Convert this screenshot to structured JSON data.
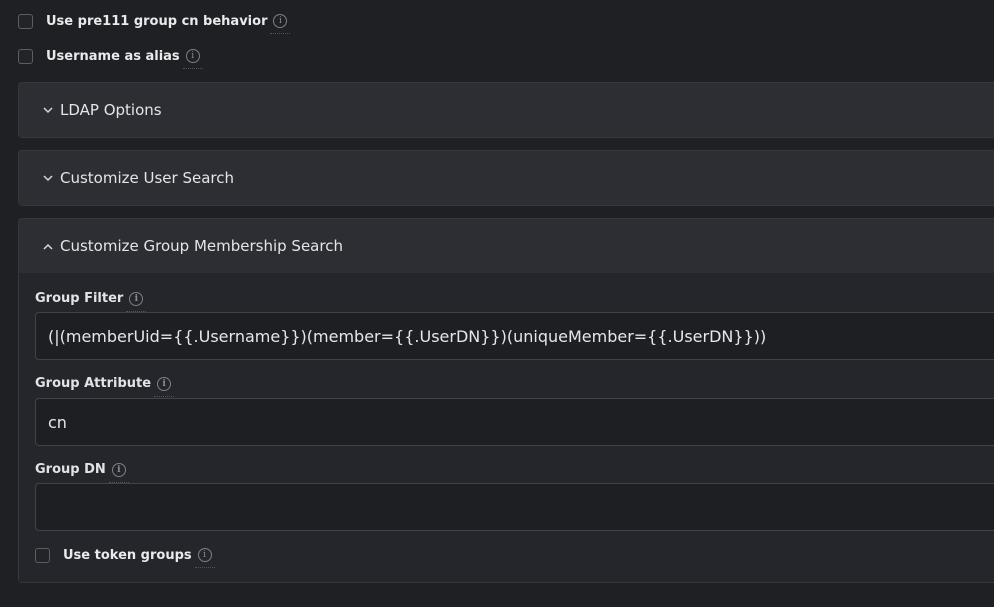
{
  "options": {
    "pre111_label": "Use pre111 group cn behavior",
    "alias_label": "Username as alias"
  },
  "sections": {
    "ldap_options": "LDAP Options",
    "user_search": "Customize User Search",
    "group_search": "Customize Group Membership Search"
  },
  "group_search": {
    "filter_label": "Group Filter",
    "filter_value": "(|(memberUid={{.Username}})(member={{.UserDN}})(uniqueMember={{.UserDN}}))",
    "attribute_label": "Group Attribute",
    "attribute_value": "cn",
    "dn_label": "Group DN",
    "dn_value": "",
    "token_groups_label": "Use token groups"
  },
  "icons": {
    "info": "info-circle-icon",
    "chevron_down": "chevron-down-icon",
    "chevron_up": "chevron-up-icon"
  },
  "colors": {
    "background": "#1f2023",
    "section_header": "#2d2e33",
    "section_body": "#25262b",
    "input_bg": "#1e1f23"
  }
}
